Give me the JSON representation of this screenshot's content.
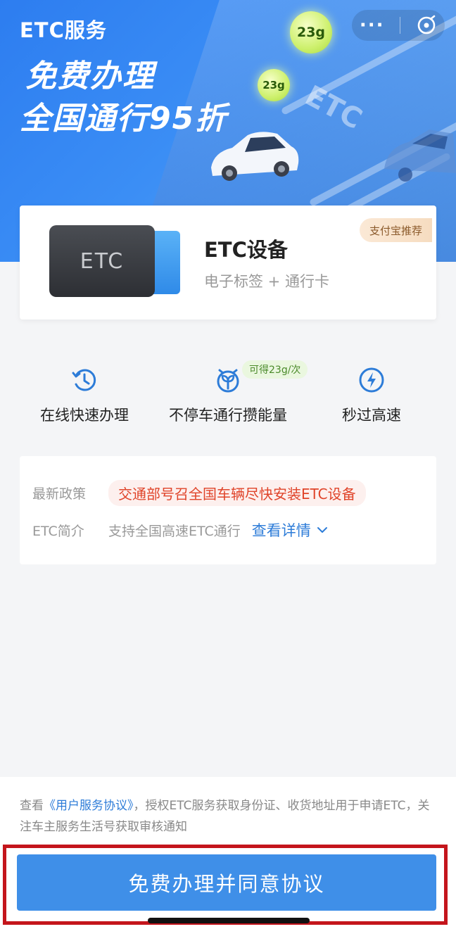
{
  "hero": {
    "title": "ETC服务",
    "slogan_line1": "免费办理",
    "slogan_line2": "全国通行95折",
    "energy_big": "23g",
    "energy_small": "23g",
    "road_text": "ETC",
    "more_icon": "more-dots-icon",
    "close_icon": "close-circle-icon"
  },
  "product": {
    "device_text": "ETC",
    "name": "ETC设备",
    "subtitle": "电子标签 + 通行卡",
    "badge": "支付宝推荐"
  },
  "features": [
    {
      "label": "在线快速办理",
      "icon": "clock-icon"
    },
    {
      "label": "不停车通行攒能量",
      "icon": "sprout-icon",
      "badge": "可得23g/次"
    },
    {
      "label": "秒过高速",
      "icon": "lightning-icon"
    }
  ],
  "policy": {
    "latest_key": "最新政策",
    "latest_value": "交通部号召全国车辆尽快安装ETC设备",
    "intro_key": "ETC简介",
    "intro_value": "支持全国高速ETC通行",
    "details_link": "查看详情"
  },
  "agreement": {
    "prefix": "查看",
    "link": "《用户服务协议》",
    "suffix": "，授权ETC服务获取身份证、收货地址用于申请ETC，关注车主服务生活号获取审核通知"
  },
  "cta": {
    "label": "免费办理并同意协议"
  },
  "colors": {
    "brand_blue": "#3f8fe8",
    "highlight_red": "#e0442a",
    "link_blue": "#2d7cd8",
    "frame_red": "#c4151c"
  }
}
